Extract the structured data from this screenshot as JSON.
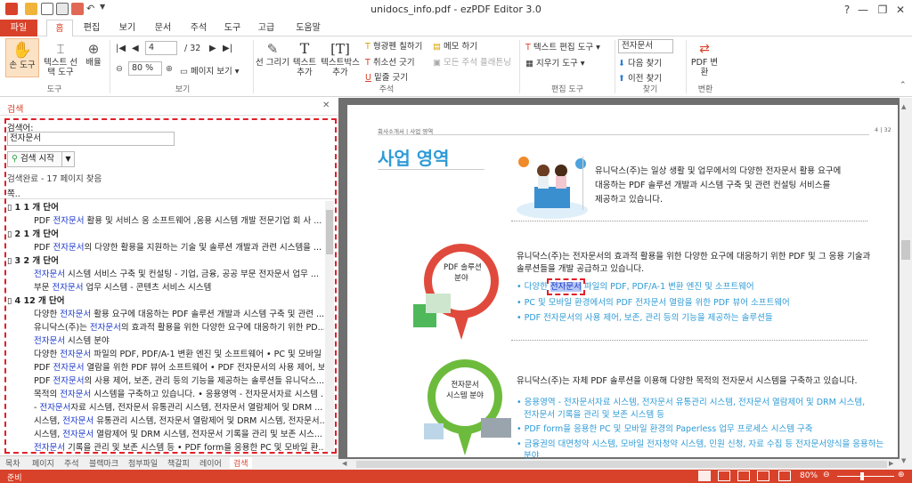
{
  "window": {
    "title": "unidocs_info.pdf - ezPDF Editor 3.0"
  },
  "tabs": [
    "파일",
    "홈",
    "편집",
    "보기",
    "문서",
    "주석",
    "도구",
    "고급",
    "도움말"
  ],
  "ribbon": {
    "hand": "손 도구",
    "textsel": "텍스트 선택 도구",
    "layout": "배율",
    "grp_tool": "도구",
    "page_num": "4",
    "page_total": "/ 32",
    "zoom": "80 %",
    "page_view": "페이지 보기",
    "grp_view": "보기",
    "line": "선 그리기",
    "text_add": "텍스트 추가",
    "textbox_add": "텍스트박스 추가",
    "highlight": "형광펜 칠하기",
    "strike": "취소선 긋기",
    "underline": "밑줄 긋기",
    "memo": "메모 하기",
    "flatten_all": "모든 주석 플래튼닝",
    "grp_annot": "주석",
    "text_edit": "텍스트 편집 도구",
    "erase": "지우기 도구",
    "grp_edit": "편집 도구",
    "find_input": "전자문서",
    "find_next": "다음 찾기",
    "find_prev": "이전 찾기",
    "grp_find": "찾기",
    "pdf_conv": "PDF 변환",
    "grp_conv": "변환"
  },
  "panel": {
    "title": "검색",
    "search_label": "검색어:",
    "search_value": "전자문서",
    "search_btn": "검색 시작",
    "result": "검색완료 - 17 페이지 찾음",
    "col": "쪽..",
    "rows": [
      {
        "type": "g",
        "text": "1   1 개 단어"
      },
      {
        "type": "r",
        "pre": "PDF ",
        "hl": "전자문서",
        "post": " 활용 및 서비스 응 소프트웨어 ,응용 시스템 개발 전문기업 회 사 ..."
      },
      {
        "type": "g",
        "text": "2   1 개 단어"
      },
      {
        "type": "r",
        "pre": "PDF ",
        "hl": "전자문서",
        "post": "의 다양한 활용을 지원하는 기술 및 솔루션 개발과 관련 시스템을 ..."
      },
      {
        "type": "g",
        "text": "3   2 개 단어"
      },
      {
        "type": "r",
        "pre": "",
        "hl": "전자문서",
        "post": " 시스템 서비스 구축 및 컨설팅 - 기업, 금융, 공공 부문 전자문서 업무 ..."
      },
      {
        "type": "r",
        "pre": "부문 ",
        "hl": "전자문서",
        "post": " 업무 시스템 - 콘텐츠 서비스 시스템"
      },
      {
        "type": "g",
        "text": "4   12 개 단어"
      },
      {
        "type": "r",
        "pre": "다양한 ",
        "hl": "전자문서",
        "post": " 활용 요구에 대응하는 PDF 솔루션 개발과 시스템 구축 및 관련 ..."
      },
      {
        "type": "r",
        "pre": "유니닥스(주)는 ",
        "hl": "전자문서",
        "post": "의 효과적 활용을 위한 다양한 요구에 대응하기 위한 PD..."
      },
      {
        "type": "r",
        "pre": "",
        "hl": "전자문서",
        "post": " 시스템 분야"
      },
      {
        "type": "r",
        "pre": "다양한 ",
        "hl": "전자문서",
        "post": " 파일의 PDF, PDF/A-1 변환 엔진 및 소프트웨어 • PC 및 모바일 ..."
      },
      {
        "type": "r",
        "pre": "PDF ",
        "hl": "전자문서",
        "post": " 열람을 위한 PDF 뷰어 소프트웨어 • PDF 전자문서의 사용 제어, 보..."
      },
      {
        "type": "r",
        "pre": "PDF ",
        "hl": "전자문서",
        "post": "의 사용 제어, 보존, 관리 등의 기능을 제공하는 솔루션들 유니닥스..."
      },
      {
        "type": "r",
        "pre": "목적의 ",
        "hl": "전자문서",
        "post": " 시스템을 구축하고 있습니다. • 응용영역 - 전자문서자료 시스템 ..."
      },
      {
        "type": "r",
        "pre": "- ",
        "hl": "전자문서",
        "post": "자료 시스템, 전자문서 유통관리 시스템, 전자문서 열람제어 및 DRM ..."
      },
      {
        "type": "r",
        "pre": "시스템, ",
        "hl": "전자문서",
        "post": " 유통관리 시스템, 전자문서 열람제어 및 DRM 시스템, 전자문서..."
      },
      {
        "type": "r",
        "pre": "시스템, ",
        "hl": "전자문서",
        "post": " 열람제어 및 DRM 시스템, 전자문서 기록을 관리 및 보존 시스..."
      },
      {
        "type": "r",
        "pre": "",
        "hl": "전자문서",
        "post": " 기록을 관리 및 보존 시스템 등 • PDF form을 응용한 PC 및 모바일 환..."
      },
      {
        "type": "r",
        "pre": "등 ",
        "hl": "전자문서",
        "post": "양식을 응용하는 분야"
      }
    ],
    "bottom_tabs": [
      "목차",
      "페이지",
      "주석",
      "블랙마크",
      "첨부파일",
      "책갈피",
      "레이어",
      "검색"
    ]
  },
  "doc": {
    "breadcrumb": "회사소개서 | 사업 영역",
    "pagenum": "4 | 32",
    "heading": "사업 영역",
    "intro1": "유니닥스(주)는 일상 생활 및 업무에서의 다양한 전자문서 활용 요구에",
    "intro2": "대응하는 PDF 솔루션 개발과 시스템 구축 및 관련 컨설팅 서비스를",
    "intro3": "제공하고 있습니다.",
    "sol_title1": "PDF 솔루션",
    "sol_title2": "분야",
    "sol_desc1": "유니닥스(주)는 전자문서의 효과적 활용을 위한 다양한 요구에 대응하기 위한 PDF 및 그 응용 기술과",
    "sol_desc2": "솔루션들을 개발 공급하고 있습니다.",
    "sol_b1_pre": "다양한 ",
    "sol_b1_hl": "전자문서",
    "sol_b1_post": " 파일의 PDF, PDF/A-1 변환 엔진 및 소프트웨어",
    "sol_b2": "PC 및 모바일 환경에서의 PDF 전자문서 열람을 위한 PDF 뷰어 소프트웨어",
    "sol_b3": "PDF 전자문서의 사용 제어, 보존, 관리 등의 기능을 제공하는 솔루션들",
    "sys_title1": "전자문서",
    "sys_title2": "시스템 분야",
    "sys_desc": "유니닥스(주)는 자체 PDF 솔루션을 이용해 다양한 목적의 전자문서 시스템을 구축하고 있습니다.",
    "sys_b1a": "응용영역 - 전자문서자료 시스템, 전자문서 유통관리 시스템, 전자문서 열람제어 및 DRM 시스템,",
    "sys_b1b": "전자문서 기록을 관리 및 보존 시스템 등",
    "sys_b2": "PDF form을 응용한 PC 및 모바일 환경의 Paperless 업무 프로세스 시스템 구축",
    "sys_b3a": "금융권의 대면청약 시스템, 모바일 전자청약 시스템, 민원 신청, 자료 수집 등 전자문서양식을 응용하는",
    "sys_b3b": "분야"
  },
  "status": {
    "left": "준비",
    "zoom": "80%"
  },
  "colors": {
    "accent": "#d9422a",
    "link": "#2f9bd6",
    "highlight": "#1a36c9"
  }
}
